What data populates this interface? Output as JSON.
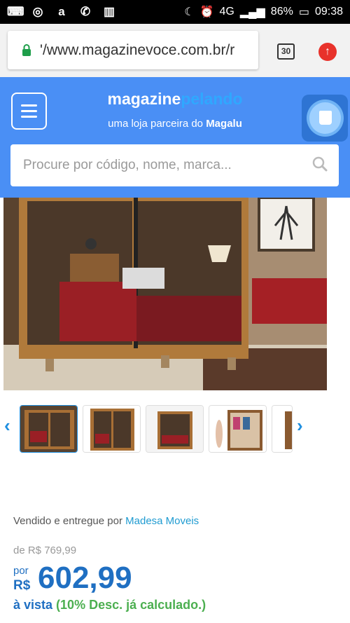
{
  "status_bar": {
    "battery": "86%",
    "time": "09:38",
    "network": "4G",
    "icons": [
      "keyboard-icon",
      "instagram-icon",
      "amazon-icon",
      "missed-call-icon",
      "book-icon",
      "moon-icon",
      "alarm-icon",
      "signal-icon",
      "battery-icon"
    ]
  },
  "browser": {
    "url": "'/www.magazinevoce.com.br/r",
    "tabs_count": "30",
    "icons": [
      "lock-icon",
      "tabs-icon",
      "upload-icon"
    ]
  },
  "header": {
    "brand_main": "magazine",
    "brand_accent": "pelando",
    "tagline_prefix": "uma loja parceira do ",
    "tagline_brand": "Magalu",
    "search_placeholder": "Procure por código, nome, marca...",
    "colors": {
      "header_bg": "#4a8ff5",
      "brand_accent": "#2fa8ff"
    }
  },
  "product": {
    "image_icon": "wardrobe-bedroom-photo",
    "thumbnails": [
      "wardrobe-closed-thumb",
      "wardrobe-mirror-thumb",
      "wardrobe-room-thumb",
      "wardrobe-open-thumb",
      "wardrobe-partial-thumb"
    ],
    "seller_prefix": "Vendido e entregue por ",
    "seller_name": "Madesa Moveis",
    "old_price": "de R$ 769,99",
    "por_label": "por",
    "currency": "R$",
    "price": "602,99",
    "payment_prefix": "à vista ",
    "payment_discount": "(10% Desc. já calculado.)",
    "colors": {
      "price": "#1f6fc2",
      "discount": "#4caf50",
      "seller_link": "#1f9bd1"
    }
  }
}
